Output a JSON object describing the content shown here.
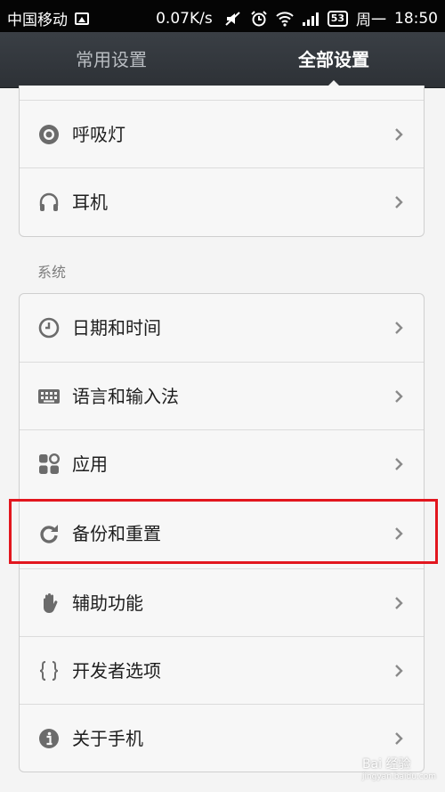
{
  "status_bar": {
    "carrier": "中国移动",
    "speed": "0.07K/s",
    "battery": "53",
    "weekday": "周一",
    "time": "18:50"
  },
  "tabs": [
    {
      "label": "常用设置",
      "active": false
    },
    {
      "label": "全部设置",
      "active": true
    }
  ],
  "top_group": [
    {
      "label": "呼吸灯",
      "icon": "notification-light-icon"
    },
    {
      "label": "耳机",
      "icon": "headphones-icon"
    }
  ],
  "system_section": {
    "title": "系统",
    "items": [
      {
        "label": "日期和时间",
        "icon": "clock-icon"
      },
      {
        "label": "语言和输入法",
        "icon": "keyboard-icon"
      },
      {
        "label": "应用",
        "icon": "apps-icon"
      },
      {
        "label": "备份和重置",
        "icon": "backup-reset-icon"
      },
      {
        "label": "辅助功能",
        "icon": "hand-icon"
      },
      {
        "label": "开发者选项",
        "icon": "braces-icon"
      },
      {
        "label": "关于手机",
        "icon": "info-icon"
      }
    ]
  },
  "watermark": {
    "text": "Bai 经验",
    "sub": "jingyan.baidu.com"
  },
  "colors": {
    "highlight": "#e2161e",
    "header": "#33373c",
    "icon": "#6b6b6b"
  }
}
